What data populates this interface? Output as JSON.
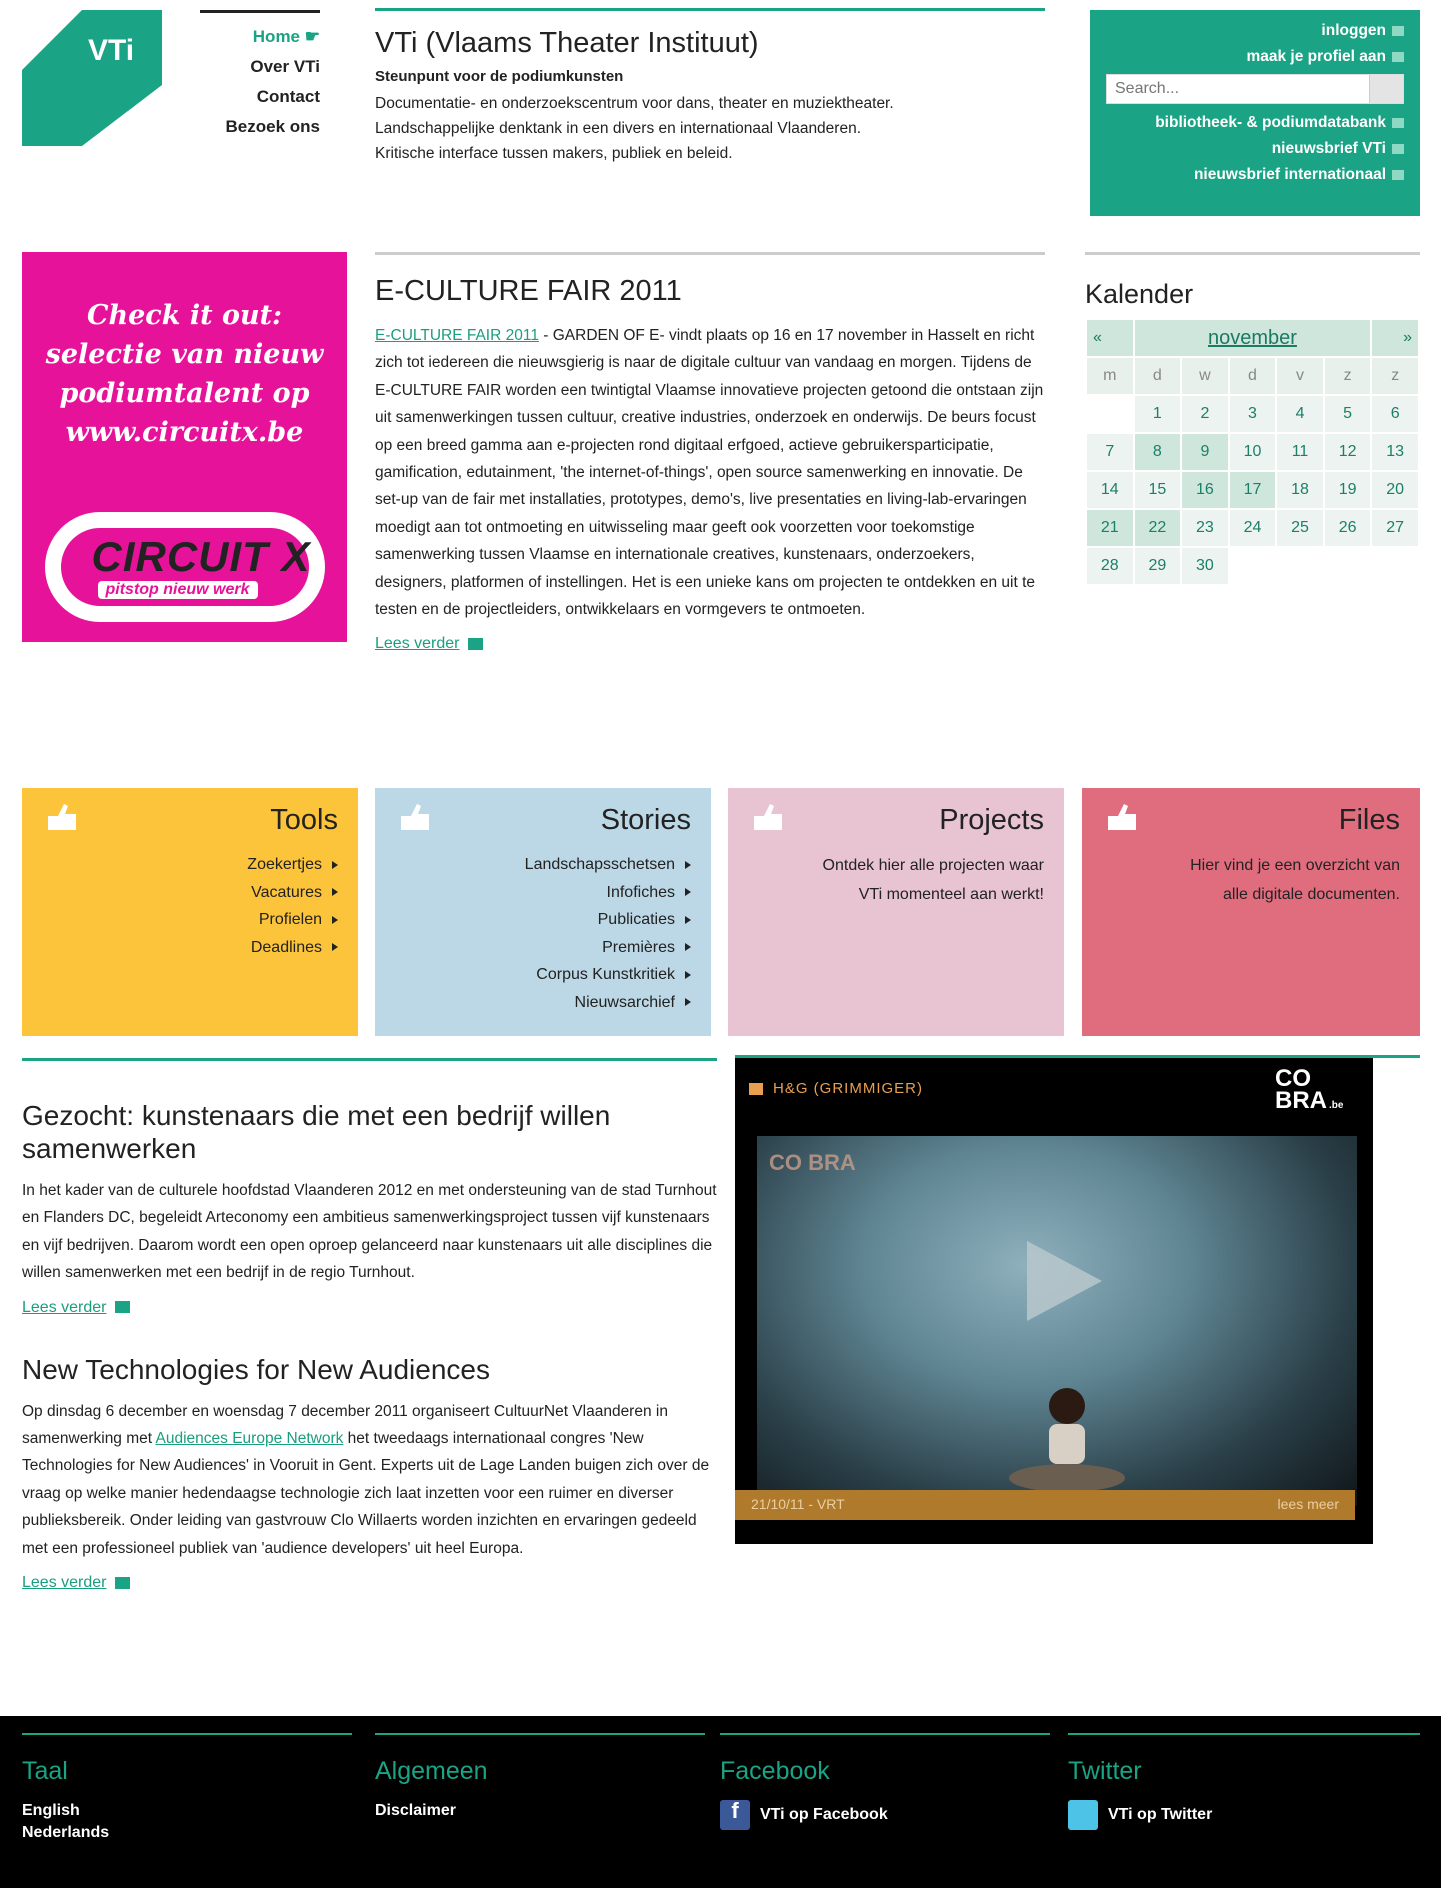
{
  "header": {
    "logo_text": "VTi",
    "nav": [
      "Home",
      "Over VTi",
      "Contact",
      "Bezoek ons"
    ],
    "title": "VTi (Vlaams Theater Instituut)",
    "subtitle": "Steunpunt voor de podiumkunsten",
    "description": [
      "Documentatie- en onderzoekscentrum voor dans, theater en muziektheater.",
      "Landschappelijke denktank in een divers en internationaal Vlaanderen.",
      "Kritische interface tussen makers, publiek en beleid."
    ]
  },
  "userbox": {
    "login": "inloggen",
    "profile": "maak je profiel aan",
    "search_placeholder": "Search...",
    "links": [
      "bibliotheek- & podiumdatabank",
      "nieuwsbrief VTi",
      "nieuwsbrief internationaal"
    ]
  },
  "promo": {
    "tagline": [
      "Check it out:",
      "selectie van nieuw",
      "podiumtalent op",
      "www.circuitx.be"
    ],
    "logo_big": "CIRCUIT X",
    "logo_small": "pitstop nieuw werk"
  },
  "feature": {
    "heading": "E-CULTURE FAIR 2011",
    "link_text": "E-CULTURE FAIR 2011",
    "body": " - GARDEN OF E- vindt plaats op 16 en 17 november in Hasselt en richt zich tot iedereen die nieuwsgierig is naar de digitale cultuur van vandaag en morgen. Tijdens de E-CULTURE FAIR worden een twintigtal Vlaamse innovatieve projecten getoond die ontstaan zijn uit samenwerkingen tussen cultuur, creative industries, onderzoek en onderwijs. De beurs focust op een breed gamma aan e-projecten rond digitaal erfgoed, actieve gebruikersparticipatie, gamification, edutainment, 'the internet-of-things', open source samenwerking en innovatie. De set-up van de fair met installaties, prototypes, demo's, live presentaties en living-lab-ervaringen moedigt aan tot ontmoeting en uitwisseling maar geeft ook voorzetten voor toekomstige samenwerking tussen Vlaamse en internationale creatives, kunstenaars, onderzoekers, designers, platformen of instellingen. Het is een unieke kans om projecten te ontdekken en uit te testen en de projectleiders, ontwikkelaars en vormgevers te ontmoeten.",
    "more": "Lees verder"
  },
  "calendar": {
    "heading": "Kalender",
    "prev": "«",
    "next": "»",
    "month": "november",
    "dow": [
      "m",
      "d",
      "w",
      "d",
      "v",
      "z",
      "z"
    ],
    "weeks": [
      [
        "",
        "1",
        "2",
        "3",
        "4",
        "5",
        "6"
      ],
      [
        "7",
        "8",
        "9",
        "10",
        "11",
        "12",
        "13"
      ],
      [
        "14",
        "15",
        "16",
        "17",
        "18",
        "19",
        "20"
      ],
      [
        "21",
        "22",
        "23",
        "24",
        "25",
        "26",
        "27"
      ],
      [
        "28",
        "29",
        "30",
        "",
        "",
        "",
        ""
      ]
    ]
  },
  "tiles": [
    {
      "title": "Tools",
      "color": "#fcc43a",
      "items": [
        "Zoekertjes",
        "Vacatures",
        "Profielen",
        "Deadlines"
      ]
    },
    {
      "title": "Stories",
      "color": "#bcd8e6",
      "items": [
        "Landschapsschetsen",
        "Infofiches",
        "Publicaties",
        "Premières",
        "Corpus Kunstkritiek",
        "Nieuwsarchief"
      ]
    },
    {
      "title": "Projects",
      "color": "#e8c3d2",
      "text": [
        "Ontdek hier alle projecten waar",
        "VTi momenteel aan werkt!"
      ]
    },
    {
      "title": "Files",
      "color": "#e06d7e",
      "text": [
        "Hier vind je een overzicht van",
        "alle digitale documenten."
      ]
    }
  ],
  "articles": [
    {
      "title": "Gezocht: kunstenaars die met een bedrijf willen samenwerken",
      "body": "In het kader van de culturele hoofdstad Vlaanderen 2012 en met ondersteuning van de stad Turnhout en Flanders DC, begeleidt Arteconomy een ambitieus samenwerkingsproject tussen vijf kunstenaars en vijf bedrijven. Daarom wordt een open oproep gelanceerd naar kunstenaars uit alle disciplines die willen samenwerken met een bedrijf in de regio Turnhout.",
      "more": "Lees verder"
    },
    {
      "title": "New Technologies for New Audiences",
      "body_a": "Op dinsdag 6 december en woensdag 7 december 2011 organiseert CultuurNet Vlaanderen in samenwerking met ",
      "link": "Audiences Europe Network",
      "body_b": " het tweedaags internationaal congres 'New Technologies for New Audiences' in Vooruit in Gent. Experts uit de Lage Landen buigen zich over de vraag op welke manier hedendaagse technologie zich laat inzetten voor een ruimer en diverser publieksbereik. Onder leiding van gastvrouw Clo Willaerts worden inzichten en ervaringen gedeeld met een professioneel publiek van 'audience developers' uit heel Europa.",
      "more": "Lees verder"
    }
  ],
  "video": {
    "label": "H&G (GRIMMIGER)",
    "brand": "CO BRA",
    "brand_sub": ".be",
    "date": "21/10/11 - VRT",
    "more": "lees meer"
  },
  "footer": {
    "taal": {
      "heading": "Taal",
      "items": [
        "English",
        "Nederlands"
      ]
    },
    "algemeen": {
      "heading": "Algemeen",
      "items": [
        "Disclaimer"
      ]
    },
    "facebook": {
      "heading": "Facebook",
      "link": "VTi op Facebook"
    },
    "twitter": {
      "heading": "Twitter",
      "link": "VTi op Twitter"
    }
  },
  "colors": {
    "accent": "#1aa384",
    "promo": "#e6139a",
    "footer": "#000000"
  }
}
